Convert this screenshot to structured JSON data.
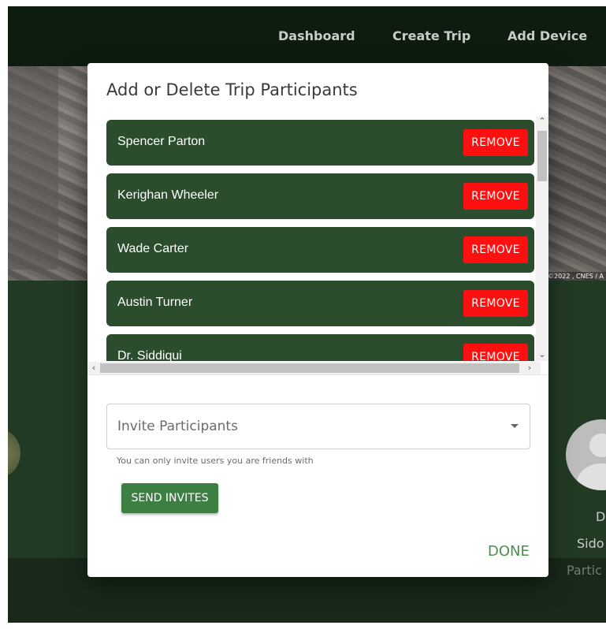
{
  "nav": {
    "dashboard": "Dashboard",
    "create_trip": "Create Trip",
    "add_device": "Add Device"
  },
  "map": {
    "credit": "©2022 , CNES / A"
  },
  "background": {
    "right_name_1": "D",
    "right_name_2": "Sido",
    "right_role": "Partic"
  },
  "modal": {
    "title": "Add or Delete Trip Participants",
    "participants": [
      {
        "name": "Spencer Parton",
        "remove_label": "REMOVE"
      },
      {
        "name": "Kerighan Wheeler",
        "remove_label": "REMOVE"
      },
      {
        "name": "Wade Carter",
        "remove_label": "REMOVE"
      },
      {
        "name": "Austin Turner",
        "remove_label": "REMOVE"
      },
      {
        "name": "Dr. Siddiqui",
        "remove_label": "REMOVE"
      }
    ],
    "invite_placeholder": "Invite Participants",
    "helper_text": "You can only invite users you are friends with",
    "send_label": "SEND INVITES",
    "done_label": "DONE"
  },
  "colors": {
    "participant_bg": "#2b4d2d",
    "remove_bg": "#ff1010",
    "send_bg": "#3d7f42",
    "done_text": "#4b8e4f"
  }
}
